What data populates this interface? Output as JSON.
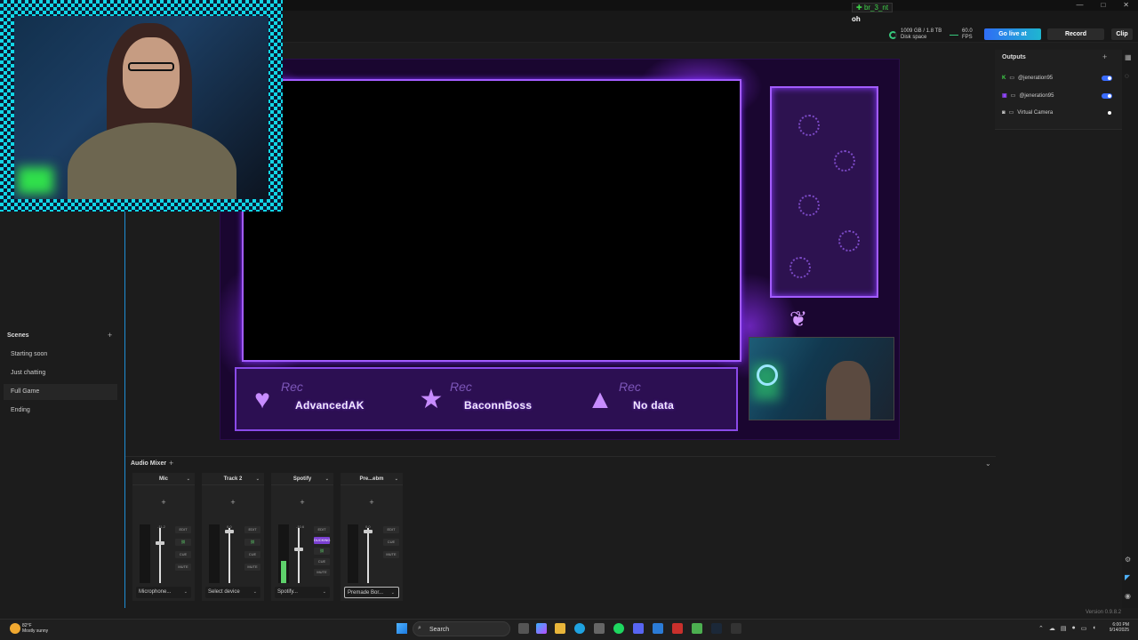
{
  "window": {
    "controls": [
      "—",
      "□",
      "✕"
    ]
  },
  "chat": {
    "tag": "br_3_nt",
    "message": "oh"
  },
  "topbar": {
    "disk_line1": "1009 GB / 1.8 TB",
    "disk_line2": "Disk space",
    "fps_value": "60.0",
    "fps_label": "FPS",
    "go_live": "Go live at",
    "record": "Record",
    "clip": "Clip"
  },
  "scenes": {
    "title": "Scenes",
    "add": "+",
    "items": [
      {
        "label": "Starting soon"
      },
      {
        "label": "Just chatting"
      },
      {
        "label": "Full Game"
      },
      {
        "label": "Ending"
      }
    ],
    "active_index": 2
  },
  "overlay": {
    "slots": [
      {
        "rec": "Rec",
        "name": "AdvancedAK",
        "icon": "♥"
      },
      {
        "rec": "Rec",
        "name": "BaconnBoss",
        "icon": "★"
      },
      {
        "rec": "Rec",
        "name": "No data",
        "icon": "▲"
      }
    ]
  },
  "outputs": {
    "title": "Outputs",
    "add": "+",
    "items": [
      {
        "platform": "Kick",
        "label": "@jeneration95",
        "on": true
      },
      {
        "platform": "Twitch",
        "label": "@jeneration95",
        "on": true
      },
      {
        "platform": "Camera",
        "label": "Virtual Camera",
        "on": false
      }
    ]
  },
  "mixer": {
    "title": "Audio Mixer",
    "add": "+",
    "collapse": "⌄",
    "tracks": [
      {
        "name": "Mic",
        "plus": "+",
        "db_left": "-9.3",
        "db_right": "-11.2",
        "fader": 0.22,
        "meter": 0.0,
        "buttons": [
          "EDIT",
          "⛓",
          "CUE",
          "MUTE"
        ],
        "device": "Microphone...",
        "device_active": false
      },
      {
        "name": "Track 2",
        "plus": "+",
        "db_left": "",
        "db_right": "0.0",
        "fader": 0.0,
        "meter": 0.0,
        "buttons": [
          "EDIT",
          "⛓",
          "CUE",
          "MUTE"
        ],
        "device": "Select device",
        "device_active": false
      },
      {
        "name": "Spotify",
        "plus": "+",
        "db_left": "-30.7",
        "db_right": "-10.6",
        "fader": 0.35,
        "meter": 0.38,
        "buttons": [
          "EDIT",
          "DUCKING",
          "⛓",
          "CUE",
          "MUTE"
        ],
        "device": "Spotify...",
        "device_active": false
      },
      {
        "name": "Pre...ebm",
        "plus": "+",
        "db_left": "",
        "db_right": "0.0",
        "fader": 0.0,
        "meter": 0.0,
        "buttons": [
          "EDIT",
          "CUE",
          "MUTE"
        ],
        "device": "Premade Bor...",
        "device_active": true
      }
    ]
  },
  "version": "Version 0.9.8.2",
  "taskbar": {
    "temperature": "82°F",
    "weather": "Mostly sunny",
    "search": "Search",
    "time": "6:00 PM",
    "date": "9/14/2025"
  },
  "colors": {
    "accent": "#2f6df5",
    "overlay_purple": "#a35cff",
    "meter_green": "#5ed16b"
  }
}
